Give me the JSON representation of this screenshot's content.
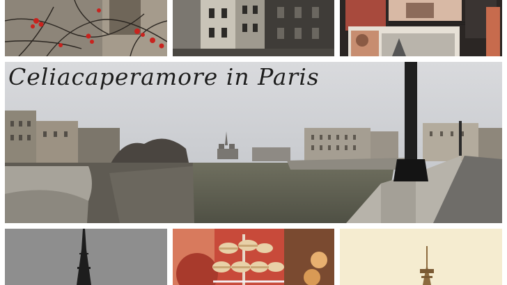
{
  "collage": {
    "title": "Celiacaperamore in Paris"
  },
  "photos": [
    {
      "name": "red berries on bare branches"
    },
    {
      "name": "narrow street with old buildings"
    },
    {
      "name": "postcards and souvenir prints"
    },
    {
      "name": "panorama of the Seine with Notre-Dame"
    },
    {
      "name": "Eiffel Tower under grey sky"
    },
    {
      "name": "stand of macarons"
    },
    {
      "name": "Eiffel Tower top on cream background"
    }
  ]
}
